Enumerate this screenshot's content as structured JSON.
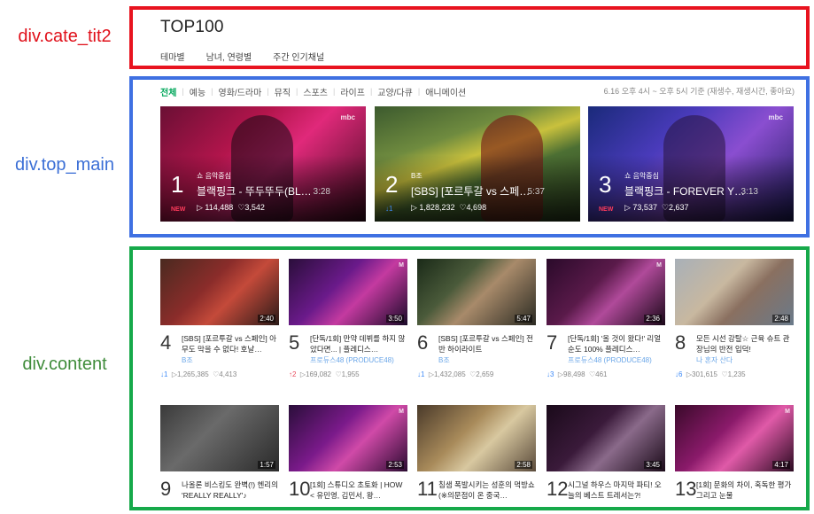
{
  "labels": {
    "cate": "div.cate_tit2",
    "top": "div.top_main",
    "content": "div.content"
  },
  "colors": {
    "red": "#e8131f",
    "blue": "#3f70e2",
    "green": "#16a94a",
    "active_filter": "#00a65a"
  },
  "header": {
    "title": "TOP100",
    "tabs": [
      "테마별",
      "남녀, 연령별",
      "주간 인기채널"
    ]
  },
  "top_main": {
    "filters": [
      "전체",
      "예능",
      "영화/드라마",
      "뮤직",
      "스포츠",
      "라이프",
      "교양/다큐",
      "애니메이션"
    ],
    "note": "6.16 오후 4시 ~ 오후 5시 기준 (재생수, 재생시간, 좋아요)",
    "cards": [
      {
        "rank": "1",
        "badge": "NEW",
        "channel": "쇼 음악중심",
        "title": "블랙핑크 - 뚜두뚜두(BL…",
        "duration": "3:28",
        "plays": "▷ 114,488",
        "likes": "♡3,542"
      },
      {
        "rank": "2",
        "badge": "↓1",
        "channel": "B조",
        "title": "[SBS] [포르투갈 vs 스페…",
        "duration": "5:37",
        "plays": "▷ 1,828,232",
        "likes": "♡4,698"
      },
      {
        "rank": "3",
        "badge": "NEW",
        "channel": "쇼 음악중심",
        "title": "블랙핑크 - FOREVER Y…",
        "duration": "3:13",
        "plays": "▷ 73,537",
        "likes": "♡2,637"
      }
    ]
  },
  "content": {
    "items": [
      {
        "rank": "4",
        "title": "[SBS] [포르투갈 vs 스페인] 아무도 막을 수 없다! 호날…",
        "channel": "B조",
        "change": "↓1",
        "plays": "▷1,265,385",
        "likes": "♡4,413",
        "duration": "2:40"
      },
      {
        "rank": "5",
        "title": "[단독/1회] 만약 데뷔를 하지 않았다면... | 플레디스…",
        "channel": "프로듀스48 (PRODUCE48)",
        "change": "↑2",
        "plays": "▷169,082",
        "likes": "♡1,955",
        "duration": "3:50"
      },
      {
        "rank": "6",
        "title": "[SBS] [포르투갈 vs 스페인] 전반 하이라이트",
        "channel": "B조",
        "change": "↓1",
        "plays": "▷1,432,085",
        "likes": "♡2,659",
        "duration": "5:47"
      },
      {
        "rank": "7",
        "title": "[단독/1회] '올 것이 왔다!' 리얼 순도 100% 플레디스…",
        "channel": "프로듀스48 (PRODUCE48)",
        "change": "↓3",
        "plays": "▷98,498",
        "likes": "♡461",
        "duration": "2:36"
      },
      {
        "rank": "8",
        "title": "모든 시선 강탈☆ 근육 슈트 관장님의 반전 입덕!",
        "channel": "나 혼자 산다",
        "change": "↓6",
        "plays": "▷301,615",
        "likes": "♡1,235",
        "duration": "2:48"
      },
      {
        "rank": "9",
        "title": "나올론 비스킹도 완벽(!) 헨리의 'REALLY REALLY'♪",
        "channel": "",
        "change": "",
        "plays": "",
        "likes": "",
        "duration": "1:57"
      },
      {
        "rank": "10",
        "title": "[1회] 스튜디오 초토화 | HOW < 유민영, 김민서, 왕…",
        "channel": "",
        "change": "",
        "plays": "",
        "likes": "",
        "duration": "2:53"
      },
      {
        "rank": "11",
        "title": "침샘 폭발시키는 성훈의 먹방쇼 (※의문점이 온 중국…",
        "channel": "",
        "change": "",
        "plays": "",
        "likes": "",
        "duration": "2:58"
      },
      {
        "rank": "12",
        "title": "시그널 하우스 마지막 파티! 오늘의 베스트 트레서는?!",
        "channel": "",
        "change": "",
        "plays": "",
        "likes": "",
        "duration": "3:45"
      },
      {
        "rank": "13",
        "title": "[1회] 문화의 차이, 혹독한 평가 그리고 눈물",
        "channel": "",
        "change": "",
        "plays": "",
        "likes": "",
        "duration": "4:17"
      }
    ]
  }
}
